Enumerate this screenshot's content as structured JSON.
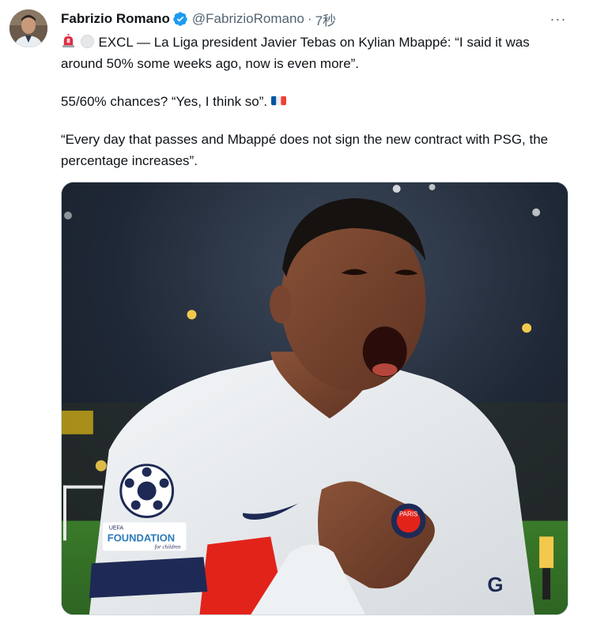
{
  "tweet": {
    "author": {
      "display_name": "Fabrizio Romano",
      "handle": "@FabrizioRomano",
      "verified": true,
      "verified_icon": "verified-badge-icon"
    },
    "separator": "·",
    "timestamp": "7秒",
    "more_icon": "more-horizontal-icon",
    "more_label": "···",
    "text": {
      "line1_emojis": [
        "rotating-light-emoji",
        "white-circle-emoji"
      ],
      "paragraph1": "EXCL — La Liga president Javier Tebas on Kylian Mbappé: “I said it was around 50% some weeks ago, now is even more”.",
      "paragraph2": "55/60% chances? “Yes, I think so”.",
      "paragraph2_emoji": "france-flag-emoji",
      "paragraph3": "“Every day that passes and Mbappé does not sign the new contract with PSG, the percentage increases”."
    },
    "media": {
      "description_icon": "photo-of-footballer-celebrating",
      "sleeve_badge_text": "FOUNDATION",
      "sleeve_badge_small": "UEFA",
      "sleeve_badge_sub": "for children",
      "crest_text": "PARIS"
    }
  },
  "colors": {
    "text_primary": "#0f1419",
    "text_secondary": "#536471",
    "verified_blue": "#1d9bf0",
    "border": "#cfd9de"
  }
}
